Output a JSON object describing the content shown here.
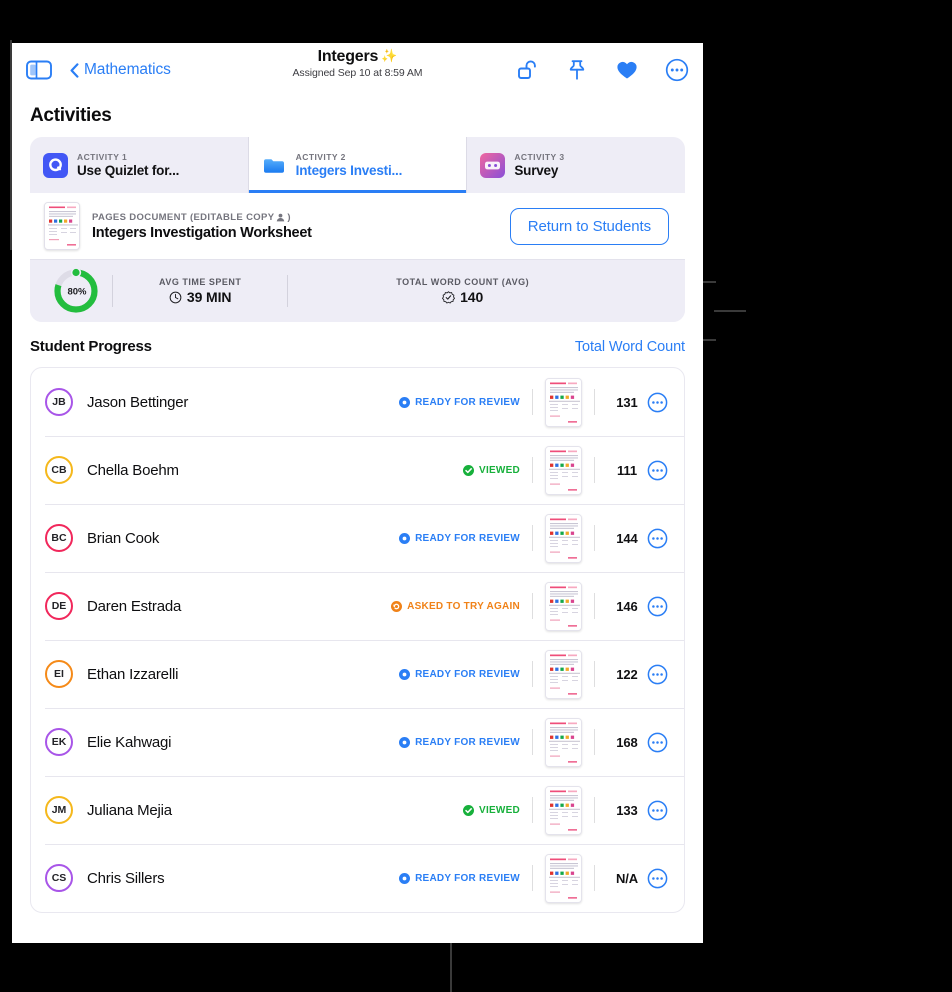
{
  "navbar": {
    "sidebar_icon": "sidebar-toggle-icon",
    "back_label": "Mathematics",
    "title": "Integers",
    "title_sparkle": "✨",
    "subtitle": "Assigned Sep 10 at 8:59 AM",
    "actions": [
      {
        "name": "unlock-icon",
        "label": "Unlock"
      },
      {
        "name": "pin-icon",
        "label": "Pin"
      },
      {
        "name": "heart-icon",
        "label": "Favorite"
      },
      {
        "name": "more-icon",
        "label": "More"
      }
    ]
  },
  "page": {
    "heading": "Activities"
  },
  "tabs": [
    {
      "kicker": "ACTIVITY 1",
      "name": "Use Quizlet for...",
      "icon": "quizlet-icon",
      "active": false
    },
    {
      "kicker": "ACTIVITY 2",
      "name": "Integers Investi...",
      "icon": "pages-folder-icon",
      "active": true
    },
    {
      "kicker": "ACTIVITY 3",
      "name": "Survey",
      "icon": "survey-icon",
      "active": false
    }
  ],
  "document": {
    "kicker_prefix": "PAGES DOCUMENT (EDITABLE COPY",
    "kicker_person_glyph": "༟",
    "kicker_suffix": ")",
    "title": "Integers Investigation Worksheet",
    "thumb_icon": "worksheet-thumbnail",
    "return_label": "Return to Students"
  },
  "stats": {
    "progress_percent": "80%",
    "progress_value": 80,
    "items": [
      {
        "label": "AVG TIME SPENT",
        "value": "39 MIN",
        "icon": "clock-icon"
      },
      {
        "label": "TOTAL WORD COUNT (AVG)",
        "value": "140",
        "icon": "seal-check-icon"
      }
    ]
  },
  "student_progress": {
    "title": "Student Progress",
    "link_label": "Total Word Count",
    "rows": [
      {
        "initials": "JB",
        "ring": "#a855e8",
        "name": "Jason Bettinger",
        "status": "READY FOR REVIEW",
        "status_kind": "ready",
        "status_color": "#2a7ef5",
        "words": "131"
      },
      {
        "initials": "CB",
        "ring": "#f5b81c",
        "name": "Chella Boehm",
        "status": "VIEWED",
        "status_kind": "viewed",
        "status_color": "#17b03b",
        "words": "111"
      },
      {
        "initials": "BC",
        "ring": "#f1275b",
        "name": "Brian Cook",
        "status": "READY FOR REVIEW",
        "status_kind": "ready",
        "status_color": "#2a7ef5",
        "words": "144"
      },
      {
        "initials": "DE",
        "ring": "#f1275b",
        "name": "Daren Estrada",
        "status": "ASKED TO TRY AGAIN",
        "status_kind": "retry",
        "status_color": "#f08218",
        "words": "146"
      },
      {
        "initials": "EI",
        "ring": "#f58a18",
        "name": "Ethan Izzarelli",
        "status": "READY FOR REVIEW",
        "status_kind": "ready",
        "status_color": "#2a7ef5",
        "words": "122"
      },
      {
        "initials": "EK",
        "ring": "#a855e8",
        "name": "Elie Kahwagi",
        "status": "READY FOR REVIEW",
        "status_kind": "ready",
        "status_color": "#2a7ef5",
        "words": "168"
      },
      {
        "initials": "JM",
        "ring": "#f5b81c",
        "name": "Juliana Mejia",
        "status": "VIEWED",
        "status_kind": "viewed",
        "status_color": "#17b03b",
        "words": "133"
      },
      {
        "initials": "CS",
        "ring": "#a855e8",
        "name": "Chris Sillers",
        "status": "READY FOR REVIEW",
        "status_kind": "ready",
        "status_color": "#2a7ef5",
        "words": "N/A"
      }
    ]
  },
  "colors": {
    "accent_blue": "#2a7ef5",
    "green": "#17b03b",
    "orange": "#f08218",
    "card_bg": "#eeedf6"
  }
}
